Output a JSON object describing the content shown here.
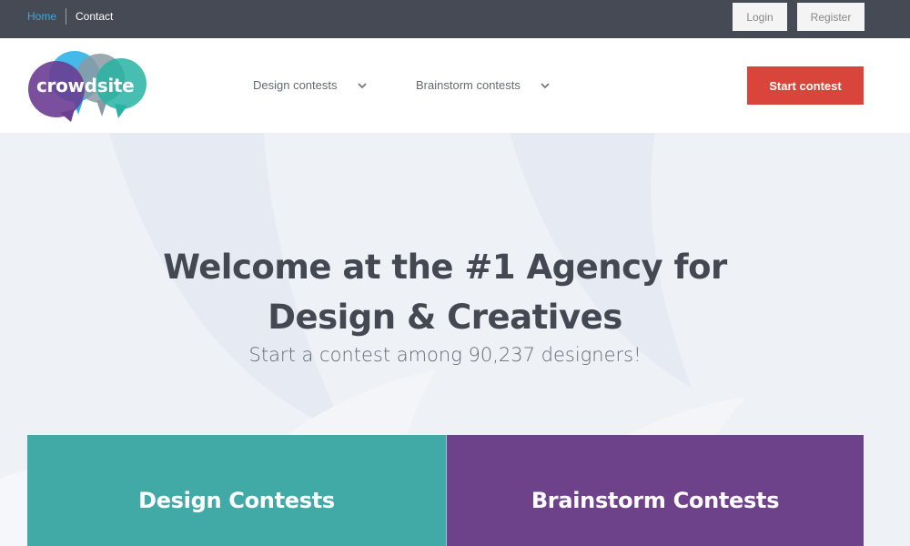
{
  "topbar": {
    "links": [
      {
        "label": "Home",
        "active": true
      },
      {
        "label": "Contact",
        "active": false
      }
    ],
    "login_label": "Login",
    "register_label": "Register"
  },
  "header": {
    "logo_text": "crowdsite",
    "nav": [
      {
        "label": "Design contests",
        "icon": "chevron-down-icon"
      },
      {
        "label": "Brainstorm contests",
        "icon": "chevron-down-icon"
      }
    ],
    "cta_label": "Start contest"
  },
  "hero": {
    "title_line1": "Welcome at the #1 Agency for",
    "title_line2": "Design & Creatives",
    "subtitle": "Start a contest among 90,237 designers!"
  },
  "cards": [
    {
      "label": "Design Contests"
    },
    {
      "label": "Brainstorm Contests"
    }
  ],
  "colors": {
    "topbar_bg": "#464a55",
    "link_active": "#3aa9d8",
    "cta_red": "#d9453a",
    "design_teal": "#41aaa6",
    "brainstorm_purple": "#6e418b",
    "heading_text": "#434852"
  }
}
